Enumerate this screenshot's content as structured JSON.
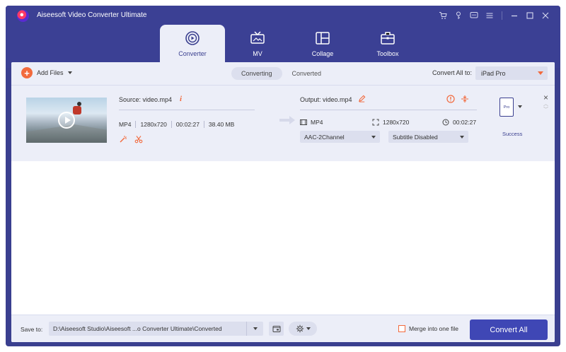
{
  "app": {
    "title": "Aiseesoft Video Converter Ultimate"
  },
  "window_icons": [
    "cart-icon",
    "key-icon",
    "feedback-icon",
    "menu-icon",
    "minimize-icon",
    "maximize-icon",
    "close-icon"
  ],
  "nav": {
    "tabs": [
      {
        "label": "Converter",
        "icon": "converter-icon",
        "active": true
      },
      {
        "label": "MV",
        "icon": "tv-icon",
        "active": false
      },
      {
        "label": "Collage",
        "icon": "collage-icon",
        "active": false
      },
      {
        "label": "Toolbox",
        "icon": "toolbox-icon",
        "active": false
      }
    ]
  },
  "toolbar": {
    "add_files": "Add Files",
    "subtabs": [
      {
        "label": "Converting",
        "active": true
      },
      {
        "label": "Converted",
        "active": false
      }
    ],
    "convert_all_to_label": "Convert All to:",
    "convert_all_to_value": "iPad Pro"
  },
  "file": {
    "source": "Source: video.mp4",
    "src_format": "MP4",
    "src_resolution": "1280x720",
    "src_duration": "00:02:27",
    "src_size": "38.40 MB",
    "output": "Output: video.mp4",
    "out_format": "MP4",
    "out_resolution": "1280x720",
    "out_duration": "00:02:27",
    "audio_track": "AAC-2Channel",
    "subtitle": "Subtitle Disabled",
    "device_label": "Pro",
    "status": "Success"
  },
  "bottom": {
    "save_to_label": "Save to:",
    "save_path": "D:\\Aiseesoft Studio\\Aiseesoft ...o Converter Ultimate\\Converted",
    "merge_label": "Merge into one file",
    "convert_all": "Convert All"
  },
  "colors": {
    "header": "#3b4094",
    "accent_orange": "#f26a3d",
    "primary_button": "#3f47b5",
    "panel": "#eceef8"
  }
}
